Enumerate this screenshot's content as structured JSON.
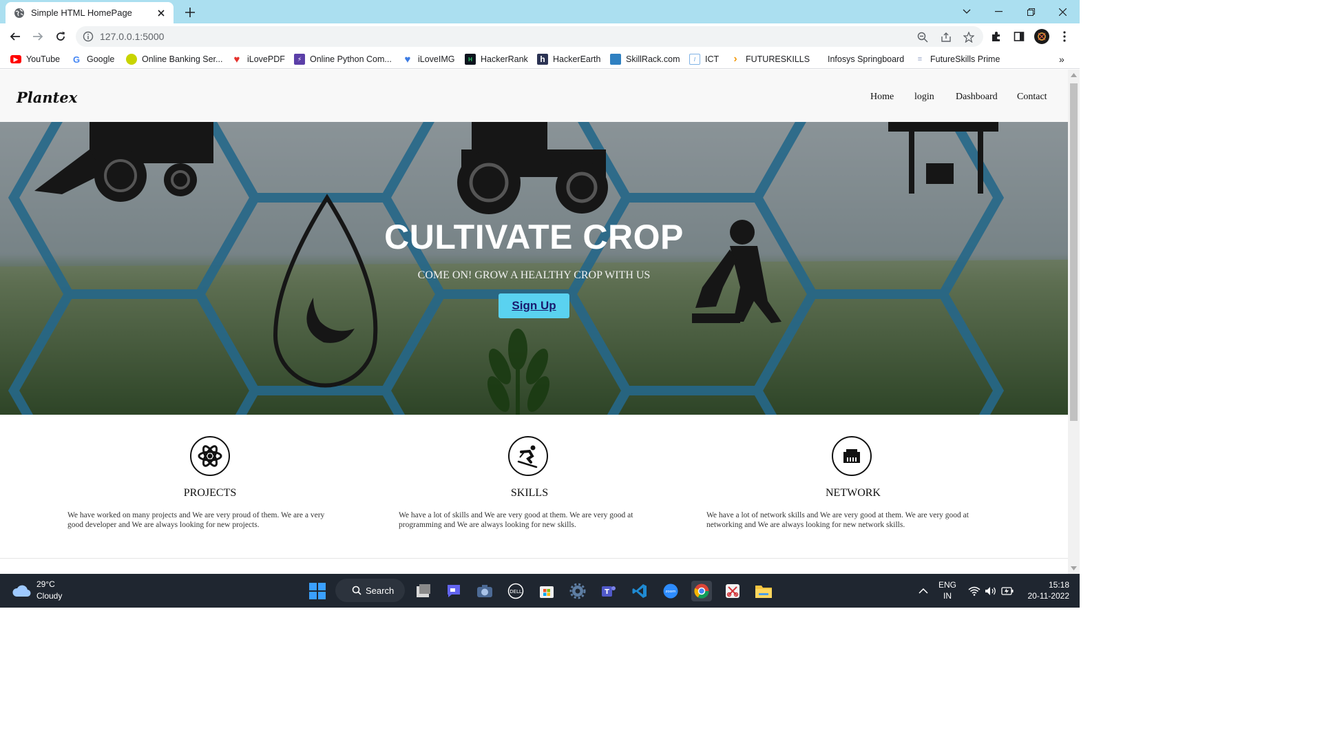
{
  "browser": {
    "tab_title": "Simple HTML HomePage",
    "url": "127.0.0.1:5000",
    "bookmarks": [
      {
        "label": "YouTube",
        "color": "#ff0000"
      },
      {
        "label": "Google",
        "color": "#4285f4"
      },
      {
        "label": "Online Banking Ser...",
        "color": "#c8d400"
      },
      {
        "label": "iLovePDF",
        "color": "#e5322d"
      },
      {
        "label": "Online Python Com...",
        "color": "#5b3fa8"
      },
      {
        "label": "iLoveIMG",
        "color": "#3c7be3"
      },
      {
        "label": "HackerRank",
        "color": "#0e141e"
      },
      {
        "label": "HackerEarth",
        "color": "#2c3454"
      },
      {
        "label": "SkillRack.com",
        "color": "#2f80c1"
      },
      {
        "label": "ICT",
        "color": "#7fb2e5"
      },
      {
        "label": "FUTURESKILLS",
        "color": "#f39c12"
      },
      {
        "label": "Infosys Springboard",
        "color": "#ffffff"
      },
      {
        "label": "FutureSkills Prime",
        "color": "#9aa7c9"
      }
    ]
  },
  "site": {
    "brand": "Plantex",
    "nav": [
      "Home",
      "login",
      "Dashboard",
      "Contact"
    ],
    "hero": {
      "title": "CULTIVATE CROP",
      "subtitle": "COME ON! GROW A HEALTHY CROP WITH US",
      "button": "Sign Up"
    },
    "features": [
      {
        "icon": "atom-icon",
        "title": "PROJECTS",
        "text_1": "We have worked on many projects and We are very proud of them. We are a very",
        "text_2": "good developer and We are always looking for new projects."
      },
      {
        "icon": "skier-icon",
        "title": "SKILLS",
        "text_1": "We have a lot of skills and We are very good at them. We are very good at",
        "text_2": "programming and We are always looking for new skills."
      },
      {
        "icon": "network-icon",
        "title": "NETWORK",
        "text_1": "We have a lot of network skills and We are very good at them. We are very good at",
        "text_2": "networking and We are always looking for new network skills."
      }
    ]
  },
  "taskbar": {
    "weather_temp": "29°C",
    "weather_desc": "Cloudy",
    "search_label": "Search",
    "lang_1": "ENG",
    "lang_2": "IN",
    "time": "15:18",
    "date": "20-11-2022"
  },
  "colors": {
    "tabstrip": "#abdff0",
    "signup_button": "#5ad2f0",
    "taskbar": "#1f2630"
  }
}
